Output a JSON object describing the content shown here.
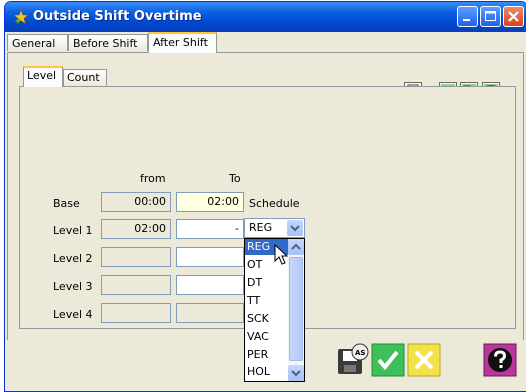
{
  "window": {
    "title": "Outside Shift Overtime"
  },
  "outer_tabs": [
    {
      "label": "General"
    },
    {
      "label": "Before Shift"
    },
    {
      "label": "After Shift"
    }
  ],
  "inner_tabs": [
    {
      "label": "Level"
    },
    {
      "label": "Count"
    }
  ],
  "columns": {
    "from": "from",
    "to": "To"
  },
  "rows": [
    {
      "label": "Base",
      "from": "00:00",
      "to": "02:00",
      "extra": "Schedule"
    },
    {
      "label": "Level 1",
      "from": "02:00",
      "to": "-",
      "schedule": "REG"
    },
    {
      "label": "Level 2",
      "from": "",
      "to": ""
    },
    {
      "label": "Level 3",
      "from": "",
      "to": ""
    },
    {
      "label": "Level 4",
      "from": "",
      "to": ""
    }
  ],
  "dropdown_options": [
    "REG",
    "OT",
    "DT",
    "TT",
    "SCK",
    "VAC",
    "PER",
    "HOL"
  ],
  "selected_option": "REG",
  "icons": {
    "title": "star-icon",
    "toolbar": [
      "checklist-icon",
      "cut-icon",
      "copy-icon",
      "paste-icon"
    ],
    "bottom": [
      "save-as-icon",
      "ok-check-icon",
      "cancel-x-icon",
      "help-icon"
    ]
  }
}
